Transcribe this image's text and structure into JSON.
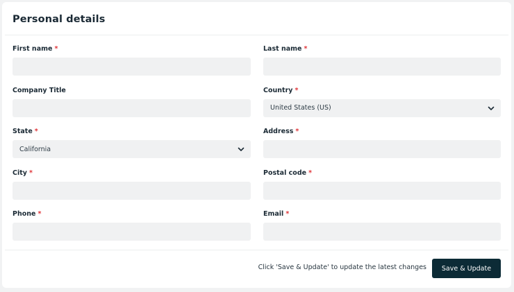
{
  "section": {
    "title": "Personal details"
  },
  "fields": {
    "first_name": {
      "label": "First name",
      "required": "*",
      "value": ""
    },
    "last_name": {
      "label": "Last name",
      "required": "*",
      "value": ""
    },
    "company_title": {
      "label": "Company Title",
      "value": ""
    },
    "country": {
      "label": "Country",
      "required": "*",
      "selected": "United States (US)"
    },
    "state": {
      "label": "State",
      "required": "*",
      "selected": "California"
    },
    "address": {
      "label": "Address",
      "required": "*",
      "value": ""
    },
    "city": {
      "label": "City",
      "required": "*",
      "value": ""
    },
    "postal_code": {
      "label": "Postal code",
      "required": "*",
      "value": ""
    },
    "phone": {
      "label": "Phone",
      "required": "*",
      "value": ""
    },
    "email": {
      "label": "Email",
      "required": "*",
      "value": ""
    }
  },
  "footer": {
    "note": "Click 'Save & Update' to update the latest changes",
    "save_label": "Save & Update"
  },
  "icons": {
    "dropdown": "chevron-down-icon"
  },
  "colors": {
    "accent_button": "#0c2b36",
    "required_marker": "#e0363a",
    "input_background": "#f0f1f2"
  }
}
